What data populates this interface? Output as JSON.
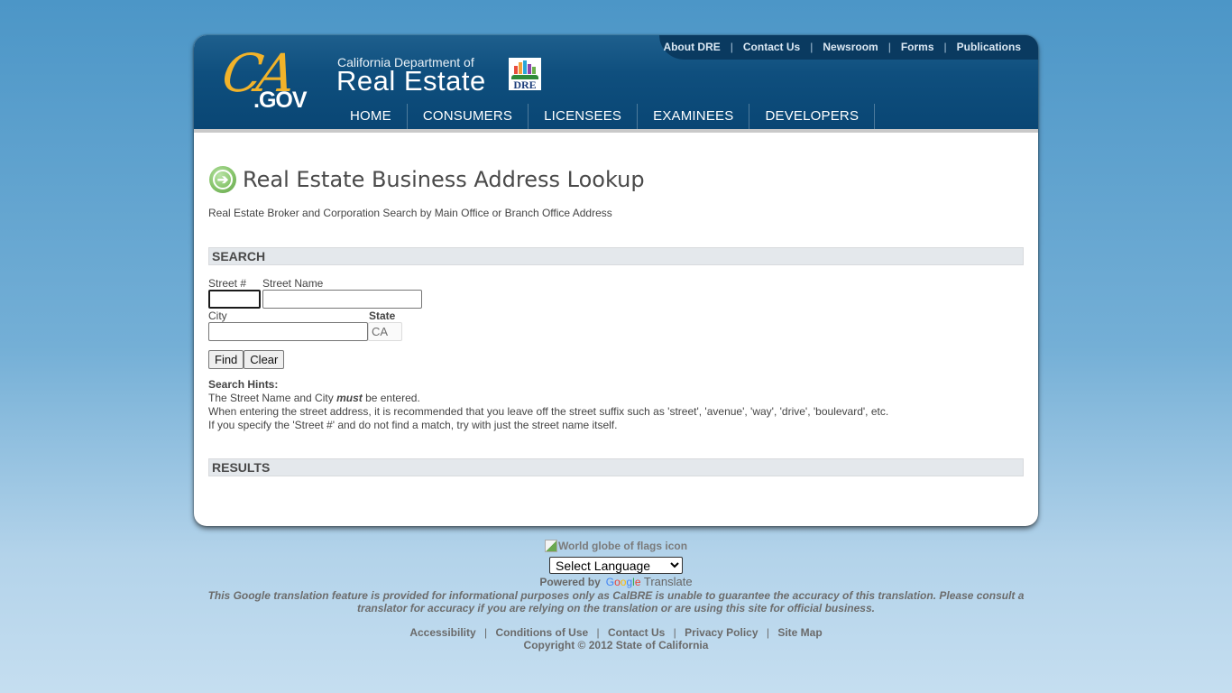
{
  "header": {
    "utility_nav": [
      "About DRE",
      "Contact Us",
      "Newsroom",
      "Forms",
      "Publications"
    ],
    "ca_logo": {
      "script": "CA",
      "gov": ".GOV"
    },
    "dept_subtitle": "California Department of",
    "dept_title": "Real Estate",
    "dre_logo_text": "DRE",
    "main_nav": [
      "HOME",
      "CONSUMERS",
      "LICENSEES",
      "EXAMINEES",
      "DEVELOPERS"
    ],
    "colors": {
      "accent_gold": "#f2b32a",
      "header_blue": "#0f4f7e"
    }
  },
  "main": {
    "title_icon": "arrow-right-circle-icon",
    "title": "Real Estate Business Address Lookup",
    "subtitle": "Real Estate Broker and Corporation Search by Main Office or Branch Office Address",
    "search_heading": "SEARCH",
    "form": {
      "street_num_label": "Street #",
      "street_num_value": "",
      "street_name_label": "Street Name",
      "street_name_value": "",
      "city_label": "City",
      "city_value": "",
      "state_label": "State",
      "state_value": "CA"
    },
    "buttons": {
      "find": "Find",
      "clear": "Clear"
    },
    "hints": {
      "heading": "Search Hints:",
      "line1_pre": "The Street Name and City ",
      "line1_em": "must",
      "line1_post": " be entered.",
      "line2": "When entering the street address, it is recommended that you leave off the street suffix such as 'street', 'avenue', 'way', 'drive', 'boulevard', etc.",
      "line3": "If you specify the 'Street #' and do not find a match, try with just the street name itself."
    },
    "results_heading": "RESULTS"
  },
  "footer": {
    "globe_alt": "World globe of flags icon",
    "language_select": "Select Language",
    "powered_by": "Powered by",
    "google": [
      "G",
      "o",
      "o",
      "g",
      "l",
      "e"
    ],
    "translate": "Translate",
    "disclaimer": "This Google translation feature is provided for informational purposes only as CalBRE is unable to guarantee the accuracy of this translation. Please consult a translator for accuracy if you are relying on the translation or are using this site for official business.",
    "links": [
      "Accessibility",
      "Conditions of Use",
      "Contact Us",
      "Privacy Policy",
      "Site Map"
    ],
    "copyright": "Copyright © 2012 State of California"
  }
}
